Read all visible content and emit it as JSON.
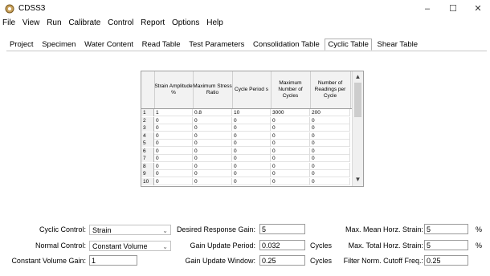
{
  "window": {
    "title": "CDSS3",
    "minimize": "–",
    "maximize": "☐",
    "close": "✕"
  },
  "menu": [
    "File",
    "View",
    "Run",
    "Calibrate",
    "Control",
    "Report",
    "Options",
    "Help"
  ],
  "tabs": [
    {
      "label": "Project",
      "active": false
    },
    {
      "label": "Specimen",
      "active": false
    },
    {
      "label": "Water Content",
      "active": false
    },
    {
      "label": "Read Table",
      "active": false
    },
    {
      "label": "Test Parameters",
      "active": false
    },
    {
      "label": "Consolidation Table",
      "active": false
    },
    {
      "label": "Cyclic Table",
      "active": true
    },
    {
      "label": "Shear Table",
      "active": false
    }
  ],
  "table": {
    "headers": [
      "Strain Amplitude %",
      "Maximum Stress Ratio",
      "Cycle Period s",
      "Maximum Number of Cycles",
      "Number of Readings per Cycle"
    ],
    "rows": [
      [
        "1",
        "1",
        "0.8",
        "10",
        "3000",
        "200"
      ],
      [
        "2",
        "0",
        "0",
        "0",
        "0",
        "0"
      ],
      [
        "3",
        "0",
        "0",
        "0",
        "0",
        "0"
      ],
      [
        "4",
        "0",
        "0",
        "0",
        "0",
        "0"
      ],
      [
        "5",
        "0",
        "0",
        "0",
        "0",
        "0"
      ],
      [
        "6",
        "0",
        "0",
        "0",
        "0",
        "0"
      ],
      [
        "7",
        "0",
        "0",
        "0",
        "0",
        "0"
      ],
      [
        "8",
        "0",
        "0",
        "0",
        "0",
        "0"
      ],
      [
        "9",
        "0",
        "0",
        "0",
        "0",
        "0"
      ],
      [
        "10",
        "0",
        "0",
        "0",
        "0",
        "0"
      ]
    ]
  },
  "form": {
    "cyclic_control": {
      "label": "Cyclic Control:",
      "value": "Strain"
    },
    "normal_control": {
      "label": "Normal Control:",
      "value": "Constant Volume"
    },
    "const_vol_gain": {
      "label": "Constant Volume Gain:",
      "value": "1"
    },
    "desired_gain": {
      "label": "Desired Response Gain:",
      "value": "5"
    },
    "gain_period": {
      "label": "Gain Update Period:",
      "value": "0.032",
      "unit": "Cycles"
    },
    "gain_window": {
      "label": "Gain Update Window:",
      "value": "0.25",
      "unit": "Cycles"
    },
    "mean_strain": {
      "label": "Max. Mean Horz. Strain:",
      "value": "5",
      "unit": "%"
    },
    "total_strain": {
      "label": "Max. Total Horz. Strain:",
      "value": "5",
      "unit": "%"
    },
    "filter_cutoff": {
      "label": "Filter Norm. Cutoff Freq.:",
      "value": "0.25"
    }
  }
}
